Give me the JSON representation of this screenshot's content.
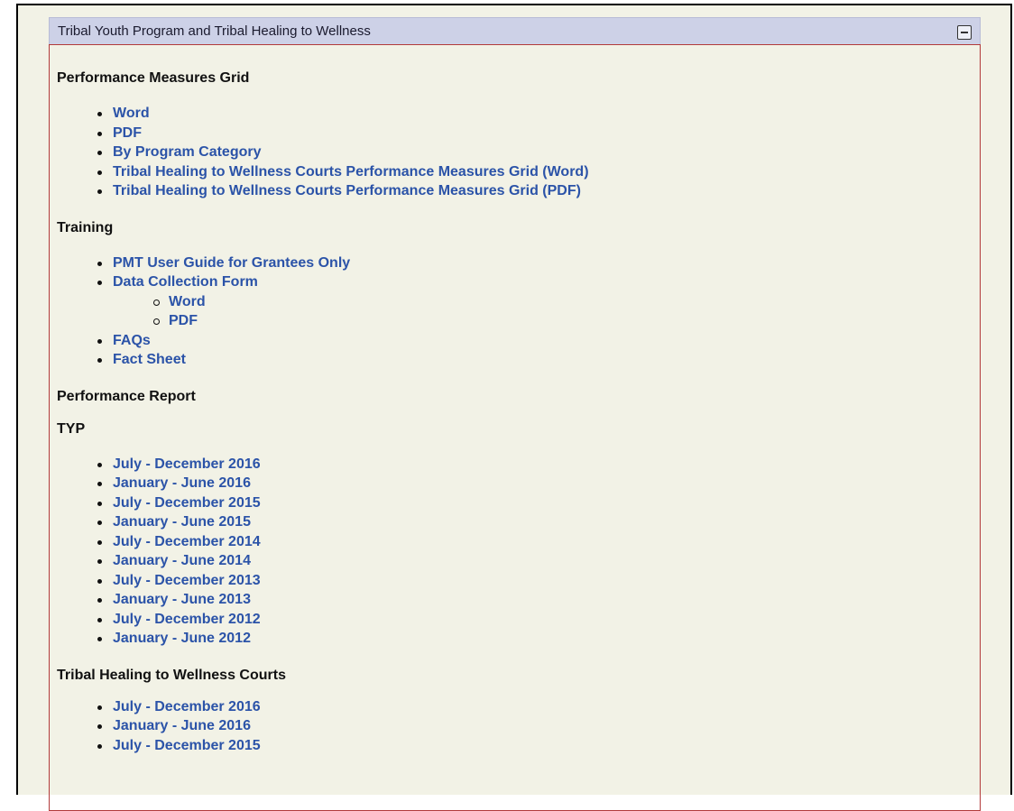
{
  "panel": {
    "title": "Tribal Youth Program and Tribal Healing to Wellness",
    "collapse_icon": "minus-square-icon"
  },
  "sections": {
    "pm_grid": {
      "heading": "Performance Measures Grid",
      "links": [
        "Word",
        "PDF",
        "By Program Category",
        "Tribal Healing to Wellness Courts Performance Measures Grid (Word)",
        "Tribal Healing to Wellness Courts Performance Measures Grid (PDF)"
      ]
    },
    "training": {
      "heading": "Training",
      "links": {
        "guide": "PMT User Guide for Grantees Only",
        "form": "Data Collection Form",
        "form_sub": [
          "Word",
          "PDF"
        ],
        "faqs": "FAQs",
        "fact": "Fact Sheet"
      }
    },
    "perf_report": {
      "heading": "Performance Report"
    },
    "typ": {
      "heading": "TYP",
      "links": [
        "July - December 2016",
        "January - June 2016",
        "July - December 2015",
        "January - June 2015",
        "July - December 2014",
        "January - June 2014",
        "July - December 2013",
        "January - June 2013",
        "July - December 2012",
        "January - June 2012"
      ]
    },
    "thwc": {
      "heading": "Tribal Healing to Wellness Courts",
      "links": [
        "July - December 2016",
        "January - June 2016",
        "July - December 2015"
      ]
    }
  },
  "colors": {
    "link": "#2b53a8",
    "header_bg": "#cdd1e7",
    "panel_border": "#b23a3a",
    "page_bg": "#f2f2e6"
  }
}
